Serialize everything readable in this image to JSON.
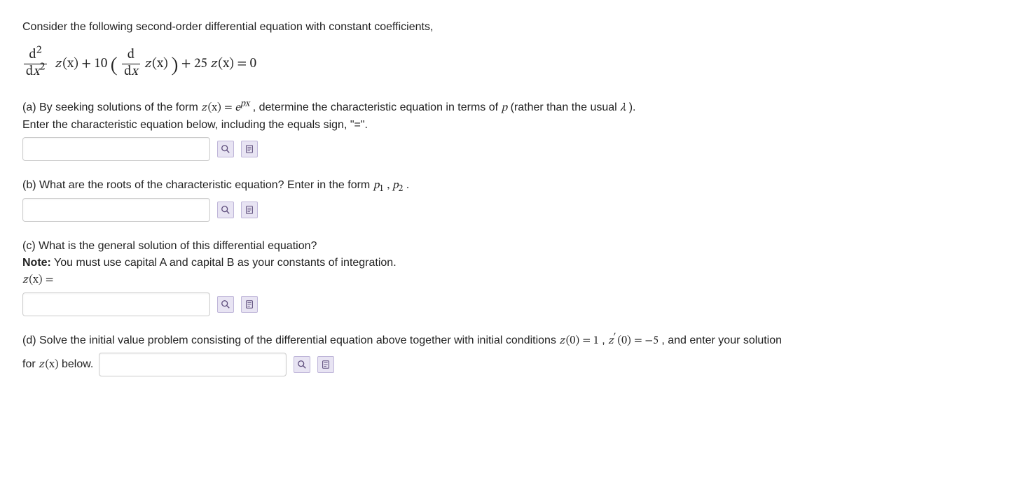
{
  "intro": "Consider the following second-order differential equation with constant coefficients,",
  "equation": {
    "frac1_num_d": "d",
    "frac1_num_exp": "2",
    "frac1_den_d": "d",
    "frac1_den_var": "x",
    "frac1_den_exp": "2",
    "z1": "z",
    "x1": "(x)",
    "plus1": " + ",
    "coef1": "10",
    "lparen": " (",
    "frac2_num_d": "d",
    "frac2_den_d": "d",
    "frac2_den_var": "x",
    "z2": " z",
    "x2": "(x)",
    "rparen": ")",
    "plus2": " + ",
    "coef2": "25",
    "z3": " z",
    "x3": "(x)",
    "eq0": " = 0"
  },
  "partA": {
    "line1_pre": "(a) By seeking solutions of the form ",
    "z": "z",
    "paren": "(x)",
    "eq": " = ",
    "e": "e",
    "px": "px",
    "line1_post": ", determine the characteristic equation in terms of ",
    "p": "p",
    "line1_end": " (rather than the usual ",
    "lambda": "λ",
    "line1_close": ").",
    "line2": "Enter the characteristic equation below, including the equals sign, \"=\"."
  },
  "partB": {
    "text_pre": "(b) What are the roots of the characteristic equation? Enter in the form ",
    "p1": "p",
    "sub1": "1",
    "comma": " , ",
    "p2": "p",
    "sub2": "2",
    "text_post": "."
  },
  "partC": {
    "line1": "(c) What is the general solution of this differential equation?",
    "note_label": "Note:",
    "note_text": " You must use capital A and capital B as your constants of integration.",
    "lhs_z": "z",
    "lhs_paren": "(x)",
    "lhs_eq": " ="
  },
  "partD": {
    "pre": "(d) Solve the initial value problem consisting of the differential equation above together with initial conditions ",
    "z0": "z",
    "paren0": "(0)",
    "eq1": " = ",
    "val1": "1",
    "comma": ", ",
    "zp": "z",
    "prime": "′",
    "paren0b": "(0)",
    "eq2": " = ",
    "val2": "−5",
    "post": ", and enter your solution",
    "line2_pre": "for ",
    "z": "z",
    "paren": "(x)",
    "line2_post": " below."
  },
  "icons": {
    "preview": "preview",
    "help": "help"
  }
}
